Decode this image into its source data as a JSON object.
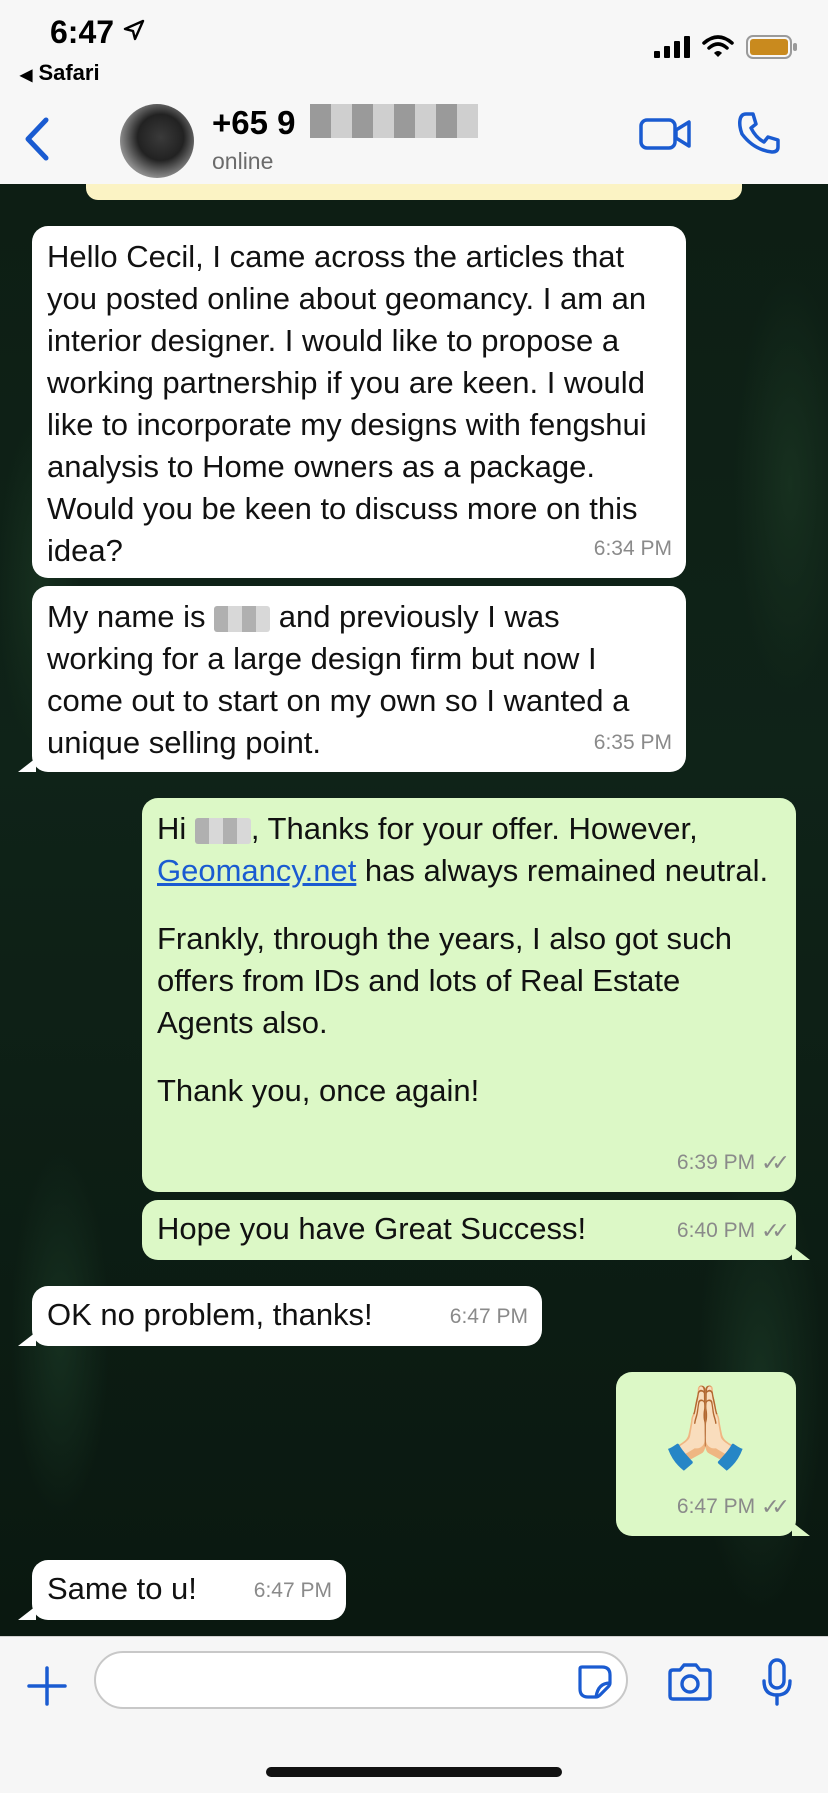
{
  "status_bar": {
    "time": "6:47",
    "back_app": "Safari"
  },
  "header": {
    "contact_name": "+65 9",
    "contact_status": "online"
  },
  "colors": {
    "accent": "#1a5bd1",
    "outgoing_bubble": "#dcf8c6",
    "incoming_bubble": "#ffffff",
    "pinned_banner": "#fbf3c4"
  },
  "messages": [
    {
      "dir": "in",
      "text": "Hello Cecil, I came across the articles that you posted online about geomancy. I am an interior designer. I would like to propose a working partnership if you are keen. I would like to incorporate my designs with fengshui analysis to Home owners as a package. Would you be keen to discuss more on this idea?",
      "time": "6:34 PM"
    },
    {
      "dir": "in",
      "text_before": "My name is ",
      "text_after": " and previously I was working for a large design firm but now I come out to start on my own so I wanted a unique selling point.",
      "time": "6:35 PM"
    },
    {
      "dir": "out",
      "greeting_before": "Hi ",
      "greeting_after": ", Thanks for your offer. However,",
      "link": "Geomancy.net",
      "link_after": " has always remained neutral.",
      "para2": "Frankly, through the years, I also got such offers from IDs and lots of Real Estate Agents also.",
      "para3": "Thank you, once again!",
      "time": "6:39 PM"
    },
    {
      "dir": "out",
      "text": "Hope you have Great Success!",
      "time": "6:40 PM"
    },
    {
      "dir": "in",
      "text": "OK no problem, thanks!",
      "time": "6:47 PM"
    },
    {
      "dir": "out",
      "emoji": "🙏🏻",
      "time": "6:47 PM"
    },
    {
      "dir": "in",
      "text": "Same to u!",
      "time": "6:47 PM"
    }
  ],
  "input": {
    "value": "",
    "placeholder": ""
  },
  "icons": {
    "back": "chevron-left-icon",
    "video": "video-call-icon",
    "phone": "phone-icon",
    "plus": "plus-icon",
    "sticker": "sticker-icon",
    "camera": "camera-icon",
    "mic": "microphone-icon"
  }
}
